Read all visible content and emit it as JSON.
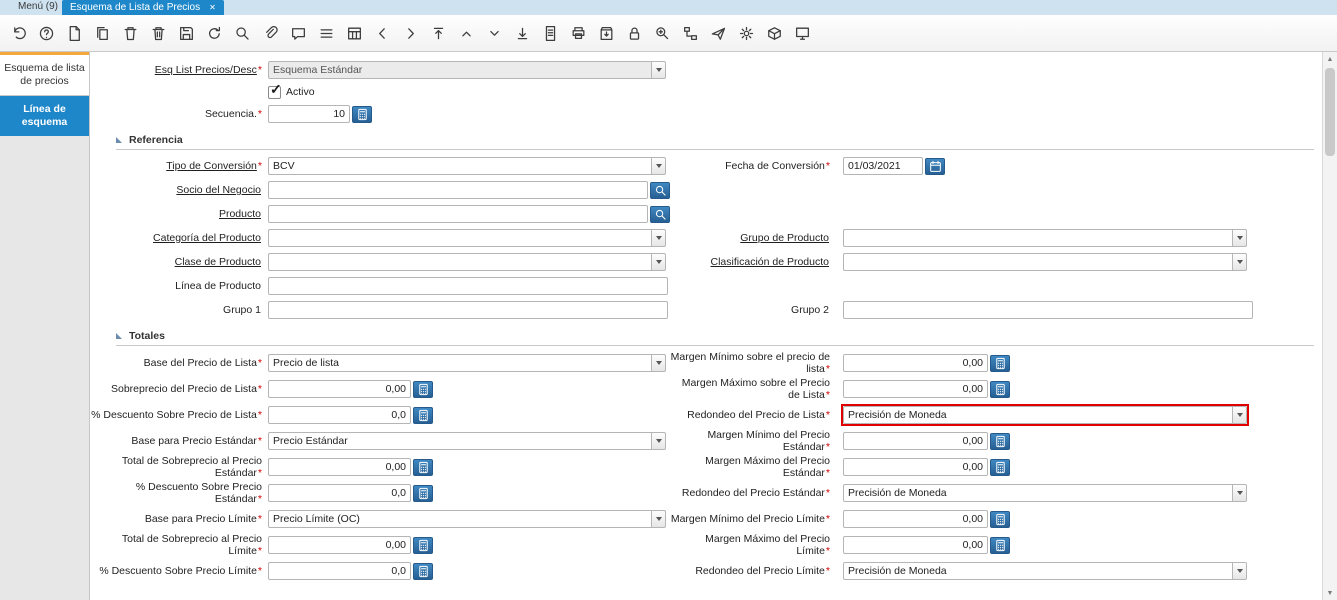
{
  "window": {
    "menu_label": "Menú (9)",
    "tab_title": "Esquema de Lista de Precios",
    "close_glyph": "✕"
  },
  "icons": {
    "check_glyph": "✓",
    "scroll_up_glyph": "▲",
    "scroll_down_glyph": "▼",
    "toolbar": [
      "undo",
      "help",
      "new-record",
      "copy-record",
      "delete-record",
      "delete-selection",
      "save",
      "refresh",
      "find",
      "attachment",
      "chat",
      "toggle-multi-row",
      "grid-toggle",
      "previous-record",
      "next-record",
      "first-record",
      "parent-record",
      "detail-record",
      "last-record",
      "report",
      "print",
      "export",
      "lock",
      "zoom-across",
      "active-workflows",
      "send-mail",
      "preferences",
      "product-info",
      "help-panel"
    ]
  },
  "colors": {
    "accent_blue": "#1d87ca",
    "button_blue": "#2e6da4",
    "highlight_red": "#e10000",
    "tab_orange": "#f2a83b"
  },
  "sidebar": {
    "tabs": [
      {
        "label": "Esquema de lista de precios",
        "active": false
      },
      {
        "label": "Línea de esquema",
        "active": true
      }
    ]
  },
  "form": {
    "top": {
      "schema": {
        "label": "Esq List Precios/Desc",
        "req": "*",
        "value": "Esquema Estándar"
      },
      "active": {
        "label": "Activo",
        "checked": true
      },
      "sequence": {
        "label": "Secuencia.",
        "req": "*",
        "value": "10"
      }
    },
    "sections": [
      {
        "title": "Referencia",
        "rows": [
          {
            "left": {
              "label": "Tipo de Conversión",
              "req": "*",
              "value": "BCV"
            },
            "right": {
              "label": "Fecha de Conversión",
              "req": "*",
              "value": "01/03/2021"
            }
          },
          {
            "left": {
              "label": "Socio del Negocio",
              "value": ""
            }
          },
          {
            "left": {
              "label": "Producto",
              "value": ""
            }
          },
          {
            "left": {
              "label": "Categoría del Producto",
              "value": ""
            },
            "right": {
              "label": "Grupo de Producto",
              "value": ""
            }
          },
          {
            "left": {
              "label": "Clase de Producto",
              "value": ""
            },
            "right": {
              "label": "Clasificación de Producto",
              "value": ""
            }
          },
          {
            "left": {
              "label": "Línea de Producto",
              "value": ""
            }
          },
          {
            "left": {
              "label": "Grupo 1",
              "value": ""
            },
            "right": {
              "label": "Grupo 2",
              "value": ""
            }
          }
        ]
      },
      {
        "title": "Totales",
        "rows": [
          {
            "left": {
              "label": "Base del Precio de Lista",
              "req": "*",
              "value": "Precio de lista"
            },
            "right": {
              "label": "Margen Mínimo sobre el precio de lista",
              "req": "*",
              "value": "0,00"
            }
          },
          {
            "left": {
              "label": "Sobreprecio del Precio de Lista",
              "req": "*",
              "value": "0,00"
            },
            "right": {
              "label": "Margen Máximo sobre el Precio de Lista",
              "req": "*",
              "value": "0,00"
            }
          },
          {
            "left": {
              "label": "% Descuento Sobre Precio de Lista",
              "req": "*",
              "value": "0,0"
            },
            "right": {
              "label": "Redondeo del Precio de Lista",
              "req": "*",
              "value": "Precisión de Moneda",
              "highlighted": true
            }
          },
          {
            "left": {
              "label": "Base para Precio Estándar",
              "req": "*",
              "value": "Precio Estándar"
            },
            "right": {
              "label": "Margen Mínimo del Precio Estándar",
              "req": "*",
              "value": "0,00"
            }
          },
          {
            "left": {
              "label": "Total de Sobreprecio al Precio Estándar",
              "req": "*",
              "value": "0,00"
            },
            "right": {
              "label": "Margen Máximo del Precio Estándar",
              "req": "*",
              "value": "0,00"
            }
          },
          {
            "left": {
              "label": "% Descuento Sobre Precio Estándar",
              "req": "*",
              "value": "0,0"
            },
            "right": {
              "label": "Redondeo del Precio Estándar",
              "req": "*",
              "value": "Precisión de Moneda"
            }
          },
          {
            "left": {
              "label": "Base para Precio Límite",
              "req": "*",
              "value": "Precio Límite (OC)"
            },
            "right": {
              "label": "Margen Mínimo del Precio Límite",
              "req": "*",
              "value": "0,00"
            }
          },
          {
            "left": {
              "label": "Total de Sobreprecio al Precio Límite",
              "req": "*",
              "value": "0,00"
            },
            "right": {
              "label": "Margen Máximo del Precio Límite",
              "req": "*",
              "value": "0,00"
            }
          },
          {
            "left": {
              "label": "% Descuento Sobre Precio Límite",
              "req": "*",
              "value": "0,0"
            },
            "right": {
              "label": "Redondeo del Precio Límite",
              "req": "*",
              "value": "Precisión de Moneda"
            }
          }
        ]
      }
    ]
  }
}
